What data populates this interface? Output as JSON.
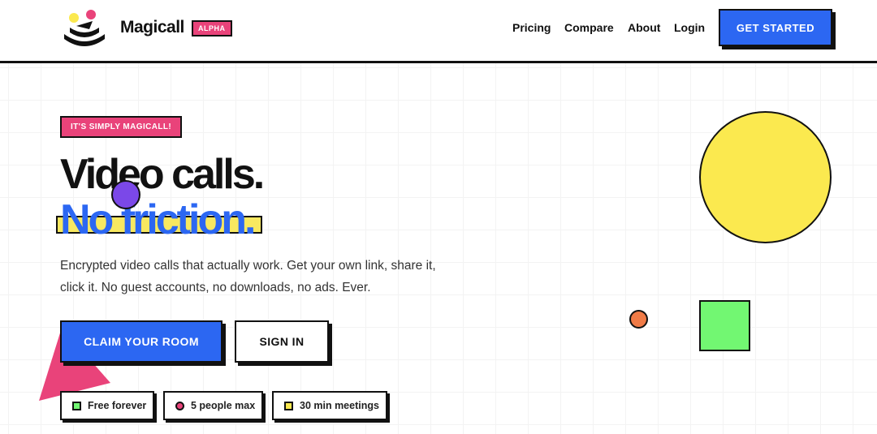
{
  "colors": {
    "accent_blue": "#2c67f2",
    "accent_pink": "#e9437a",
    "accent_yellow": "#fbe94f",
    "accent_green": "#72f772",
    "accent_orange": "#f07b47",
    "accent_purple": "#7b48e8"
  },
  "header": {
    "brand": "Magicall",
    "badge": "ALPHA",
    "logo_icon": "magicall-logo-icon",
    "nav": {
      "pricing": "Pricing",
      "compare": "Compare",
      "about": "About",
      "login": "Login"
    },
    "cta": "GET STARTED"
  },
  "hero": {
    "tagline": "IT'S SIMPLY MAGICALL!",
    "headline_line1": "Video calls.",
    "headline_line2": "No friction.",
    "subtext": "Encrypted video calls that actually work. Get your own link, share it, click it. No guest accounts, no downloads, no ads. Ever.",
    "primary_button": "CLAIM YOUR ROOM",
    "secondary_button": "SIGN IN",
    "features": [
      {
        "label": "Free forever",
        "color": "#72f772",
        "shape": "square"
      },
      {
        "label": "5 people max",
        "color": "#e9437a",
        "shape": "circle"
      },
      {
        "label": "30 min meetings",
        "color": "#fbe94f",
        "shape": "square"
      }
    ]
  }
}
